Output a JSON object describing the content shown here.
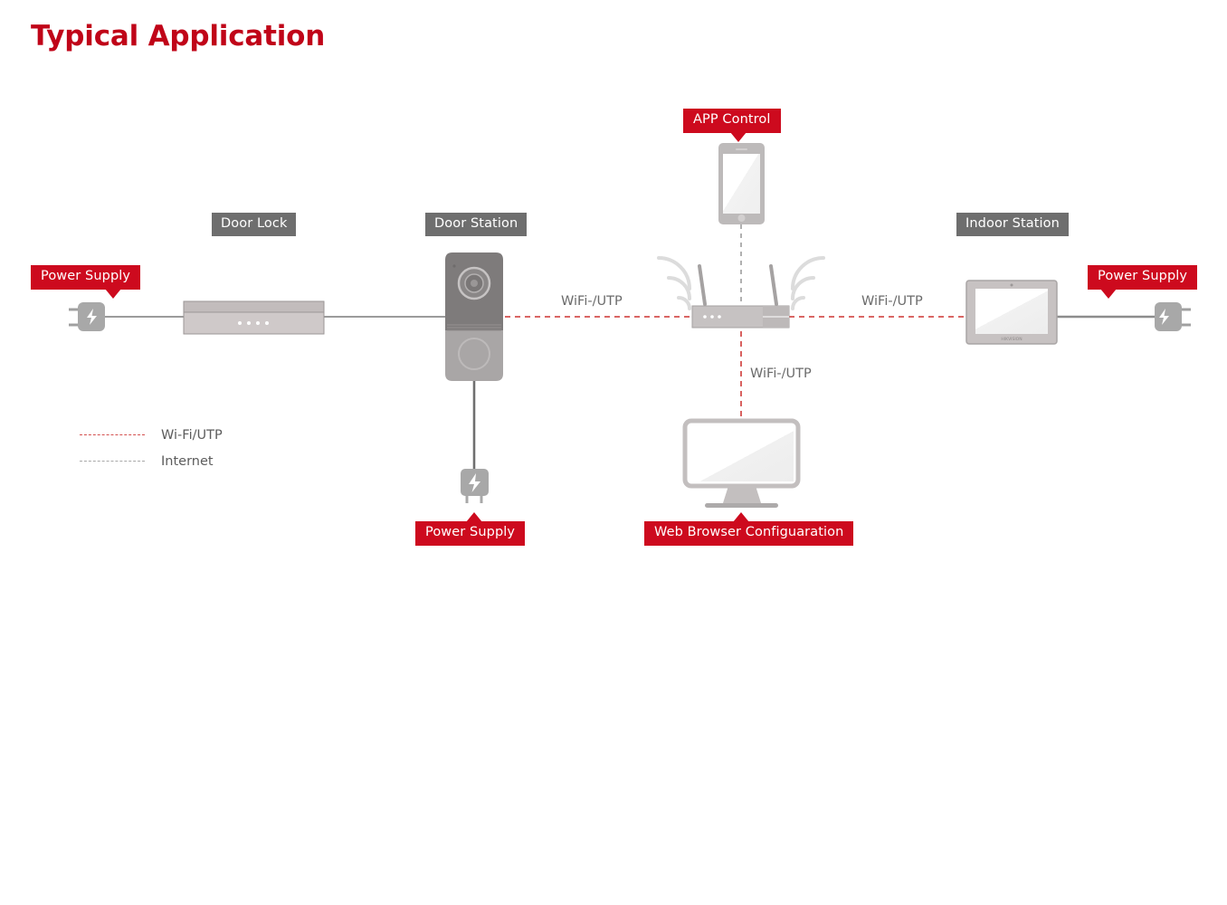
{
  "page": {
    "title": "Typical Application",
    "title_color": "#c00418",
    "background": "#ffffff"
  },
  "colors": {
    "accent_red": "#cd0a1e",
    "title_red": "#c00418",
    "label_grey": "#6e6e6e",
    "wifi_line": "#d4504f",
    "internet_line": "#a8a8a8",
    "device_grey": "#a9a9a9",
    "device_light": "#d5d0d0",
    "text_grey": "#6b6b6b"
  },
  "device_labels": [
    {
      "name": "door-lock",
      "text": "Door Lock"
    },
    {
      "name": "door-station",
      "text": "Door Station"
    },
    {
      "name": "indoor-station",
      "text": "Indoor Station"
    }
  ],
  "callouts": [
    {
      "name": "power-supply-left",
      "text": "Power Supply",
      "tail": "down"
    },
    {
      "name": "app-control",
      "text": "APP Control",
      "tail": "down"
    },
    {
      "name": "power-supply-right",
      "text": "Power Supply",
      "tail": "down"
    },
    {
      "name": "power-supply-door-station",
      "text": "Power Supply",
      "tail": "up"
    },
    {
      "name": "web-browser-configuration",
      "text": "Web Browser Configuaration",
      "tail": "up"
    }
  ],
  "connection_labels": [
    {
      "name": "conn-label-door-to-router",
      "text": "WiFi-/UTP"
    },
    {
      "name": "conn-label-router-to-indoor",
      "text": "WiFi-/UTP"
    },
    {
      "name": "conn-label-router-to-pc",
      "text": "WiFi-/UTP"
    }
  ],
  "legend": {
    "items": [
      {
        "name": "legend-wifi-utp",
        "text": "Wi-Fi/UTP",
        "style": "red-dashed",
        "color": "#d4504f"
      },
      {
        "name": "legend-internet",
        "text": "Internet",
        "style": "grey-dashed",
        "color": "#a8a8a8"
      }
    ]
  },
  "devices": {
    "power_plug_left": {
      "name": "power-plug-left",
      "icon": "power-plug-icon"
    },
    "door_lock": {
      "name": "door-lock-device",
      "icon": "door-lock-icon",
      "indicator_dots": 4
    },
    "door_station": {
      "name": "door-station-device",
      "icon": "door-station-icon"
    },
    "door_station_adapter": {
      "name": "power-adapter-icon",
      "icon": "power-adapter-icon"
    },
    "router": {
      "name": "router-device",
      "icon": "router-icon",
      "antennas": 2,
      "indicator_dots": 3
    },
    "smartphone": {
      "name": "smartphone-device",
      "icon": "smartphone-icon"
    },
    "monitor": {
      "name": "monitor-device",
      "icon": "monitor-icon"
    },
    "indoor_station": {
      "name": "indoor-station-device",
      "icon": "indoor-station-icon",
      "brand_text": "HIKVISION"
    },
    "power_plug_right": {
      "name": "power-plug-right",
      "icon": "power-plug-icon"
    }
  }
}
